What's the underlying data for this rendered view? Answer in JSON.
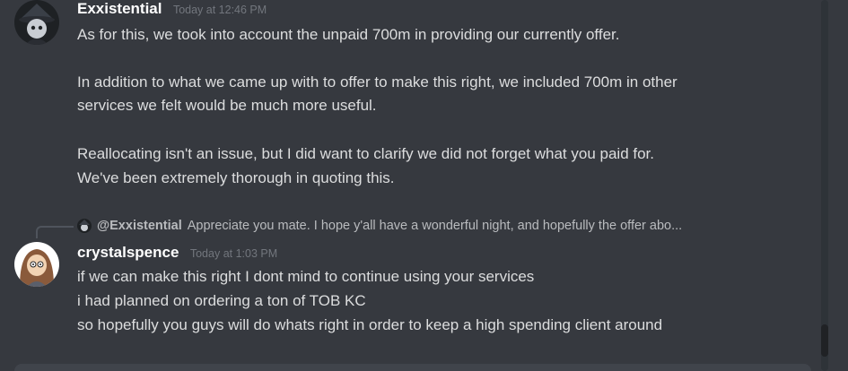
{
  "messages": [
    {
      "username": "Exxistential",
      "timestamp": "Today at 12:46 PM",
      "lines": [
        "As for this, we took into account the unpaid 700m in providing our currently offer.",
        "",
        "In addition to what we came up with to offer to make this right, we included 700m in other",
        "services we felt would be much more useful.",
        "",
        "Reallocating isn't an issue, but I did want to clarify we did not forget what you paid for.",
        "We've been extremely thorough in quoting this."
      ]
    },
    {
      "reply": {
        "mention": "@Exxistential",
        "preview": "Appreciate you mate.   I hope y'all have a wonderful night, and hopefully the offer abo..."
      },
      "username": "crystalspence",
      "timestamp": "Today at 1:03 PM",
      "lines": [
        "if we can make this right I dont mind to continue using your services",
        "i had planned on ordering a ton of TOB KC",
        "so hopefully you guys will do whats right in order to keep a high spending client around"
      ]
    }
  ],
  "colors": {
    "background": "#36393f",
    "username": "#ffffff",
    "text": "#dcddde",
    "timestamp": "#72767d"
  }
}
